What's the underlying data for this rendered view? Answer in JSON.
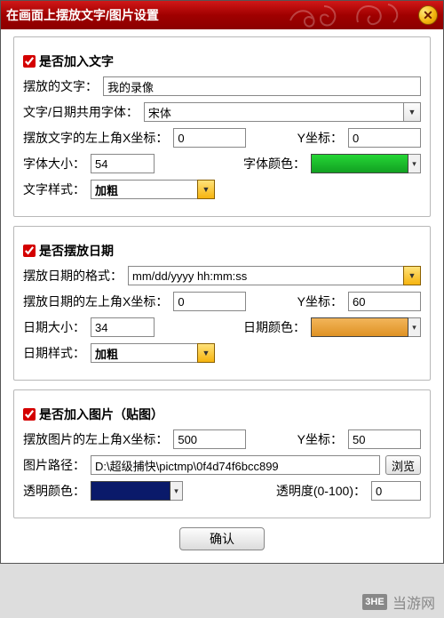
{
  "titlebar": {
    "title": "在画面上摆放文字/图片设置",
    "close": "✕"
  },
  "text": {
    "enable_label": "是否加入文字",
    "content_label": "摆放的文字：",
    "content_value": "我的录像",
    "font_label": "文字/日期共用字体：",
    "font_value": "宋体",
    "x_label": "摆放文字的左上角X坐标：",
    "x_value": "0",
    "y_label": "Y坐标：",
    "y_value": "0",
    "size_label": "字体大小：",
    "size_value": "54",
    "color_label": "字体颜色：",
    "color_value": "#1fbf2f",
    "style_label": "文字样式：",
    "style_value": "加粗"
  },
  "date": {
    "enable_label": "是否摆放日期",
    "format_label": "摆放日期的格式：",
    "format_value": "mm/dd/yyyy hh:mm:ss",
    "x_label": "摆放日期的左上角X坐标：",
    "x_value": "0",
    "y_label": "Y坐标：",
    "y_value": "60",
    "size_label": "日期大小：",
    "size_value": "34",
    "color_label": "日期颜色：",
    "color_value": "#e8a43c",
    "style_label": "日期样式：",
    "style_value": "加粗"
  },
  "image": {
    "enable_label": "是否加入图片（贴图）",
    "x_label": "摆放图片的左上角X坐标：",
    "x_value": "500",
    "y_label": "Y坐标：",
    "y_value": "50",
    "path_label": "图片路径：",
    "path_value": "D:\\超级捕快\\pictmp\\0f4d74f6bcc899",
    "browse_label": "浏览",
    "trans_color_label": "透明颜色：",
    "trans_color_value": "#0a1a6a",
    "opacity_label": "透明度(0-100)：",
    "opacity_value": "0"
  },
  "confirm_label": "确认",
  "watermark": {
    "logo": "3HE",
    "text": "当游网"
  }
}
